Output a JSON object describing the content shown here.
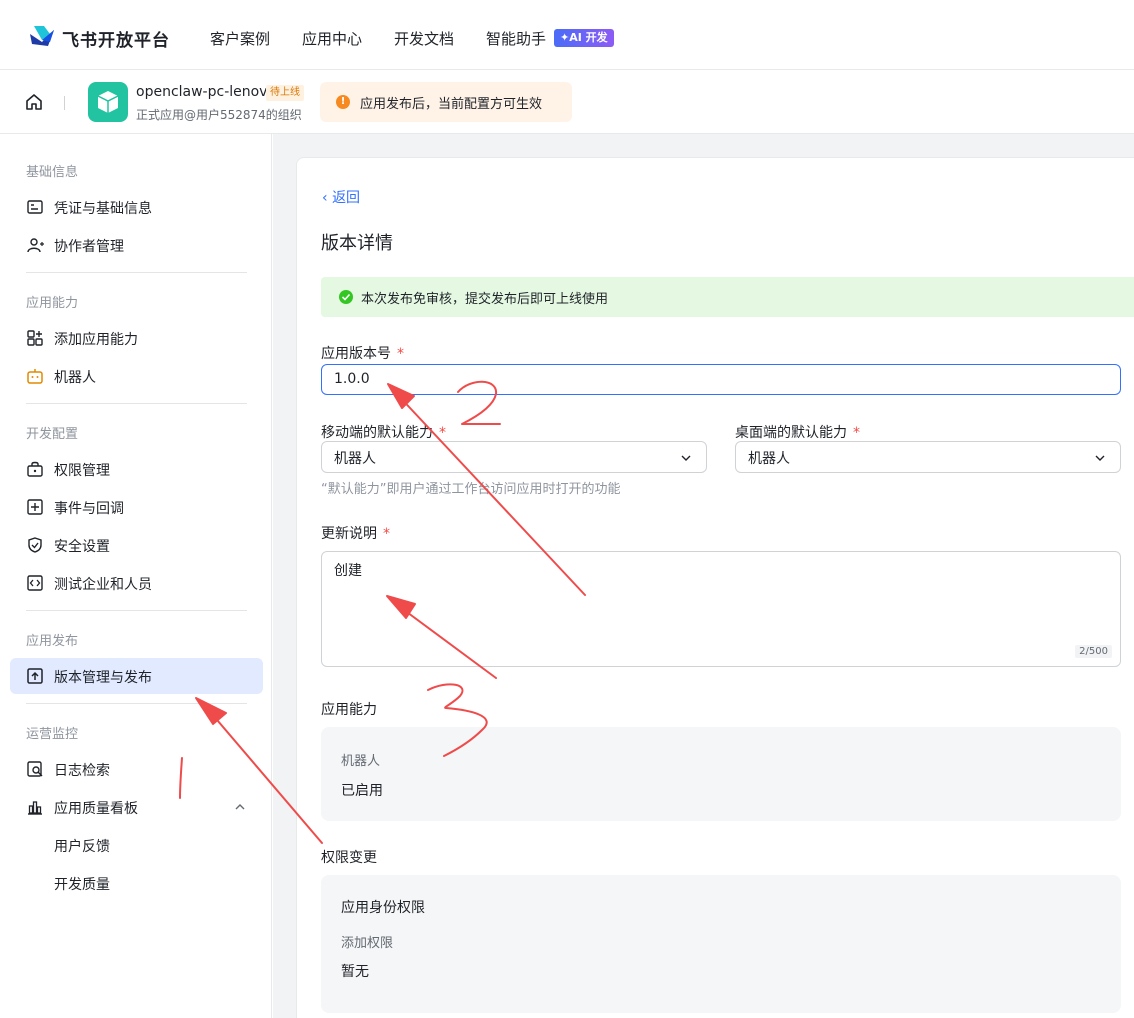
{
  "topnav": {
    "logo_text": "飞书开放平台",
    "items": [
      "客户案例",
      "应用中心",
      "开发文档",
      "智能助手"
    ],
    "ai_badge": "✦AI 开发"
  },
  "app": {
    "name": "openclaw-pc-lenovo",
    "status_tag": "待上线",
    "org": "正式应用@用户552874的组织",
    "notice": "应用发布后，当前配置方可生效"
  },
  "sidebar": {
    "sections": [
      {
        "title": "基础信息",
        "items": [
          {
            "label": "凭证与基础信息",
            "icon": "credential-icon"
          },
          {
            "label": "协作者管理",
            "icon": "user-add-icon"
          }
        ]
      },
      {
        "title": "应用能力",
        "items": [
          {
            "label": "添加应用能力",
            "icon": "grid-add-icon"
          },
          {
            "label": "机器人",
            "icon": "robot-icon"
          }
        ]
      },
      {
        "title": "开发配置",
        "items": [
          {
            "label": "权限管理",
            "icon": "lock-icon"
          },
          {
            "label": "事件与回调",
            "icon": "event-icon"
          },
          {
            "label": "安全设置",
            "icon": "shield-icon"
          },
          {
            "label": "测试企业和人员",
            "icon": "code-icon"
          }
        ]
      },
      {
        "title": "应用发布",
        "items": [
          {
            "label": "版本管理与发布",
            "icon": "upload-icon",
            "active": true
          }
        ]
      },
      {
        "title": "运营监控",
        "items": [
          {
            "label": "日志检索",
            "icon": "log-search-icon"
          },
          {
            "label": "应用质量看板",
            "icon": "bar-chart-icon",
            "expanded": true
          }
        ]
      }
    ],
    "sub_items": [
      "用户反馈",
      "开发质量"
    ]
  },
  "main": {
    "back_label": "返回",
    "title": "版本详情",
    "success_message": "本次发布免审核，提交发布后即可上线使用",
    "version_label": "应用版本号",
    "version_value": "1.0.0",
    "mobile_label": "移动端的默认能力",
    "mobile_value": "机器人",
    "desktop_label": "桌面端的默认能力",
    "desktop_value": "机器人",
    "hint": "“默认能力”即用户通过工作台访问应用时打开的功能",
    "notes_label": "更新说明",
    "notes_value": "创建",
    "notes_counter": "2/500",
    "capability_title": "应用能力",
    "capability_name": "机器人",
    "capability_status": "已启用",
    "permission_title": "权限变更",
    "permission_section": "应用身份权限",
    "permission_add_label": "添加权限",
    "permission_none": "暂无",
    "required_mark": "*"
  },
  "colors": {
    "accent": "#3370ff",
    "annotation": "#ef4b4b",
    "success": "#34c724",
    "warning": "#f68a20"
  }
}
